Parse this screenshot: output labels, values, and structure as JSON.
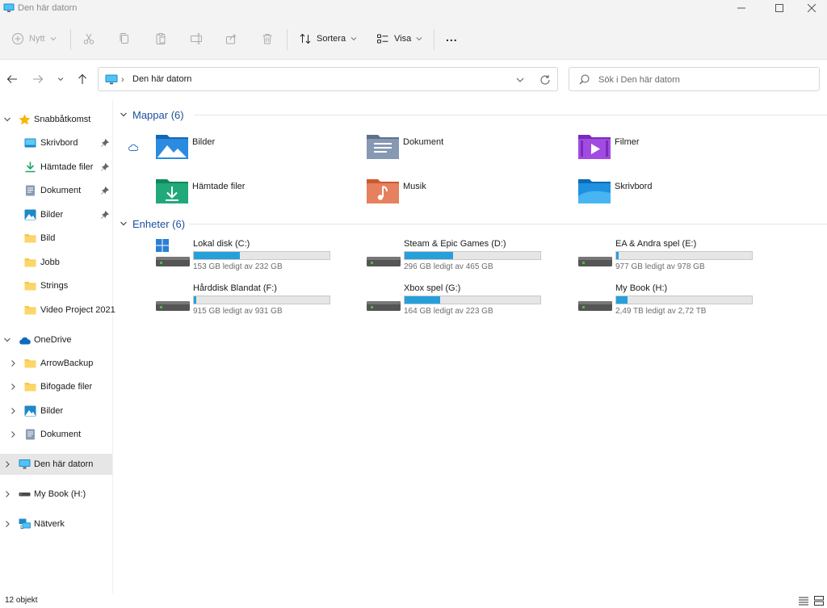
{
  "window": {
    "title": "Den här datorn"
  },
  "toolbar": {
    "new_label": "Nytt",
    "sort_label": "Sortera",
    "view_label": "Visa",
    "more_label": "..."
  },
  "address": {
    "path": "Den här datorn",
    "search_placeholder": "Sök i Den här datorn"
  },
  "sidebar": {
    "quick_access": {
      "label": "Snabbåtkomst",
      "items": [
        {
          "label": "Skrivbord",
          "icon": "desktop-icon",
          "pinned": true
        },
        {
          "label": "Hämtade filer",
          "icon": "download-icon",
          "pinned": true
        },
        {
          "label": "Dokument",
          "icon": "document-icon",
          "pinned": true
        },
        {
          "label": "Bilder",
          "icon": "pictures-icon",
          "pinned": true
        },
        {
          "label": "Bild",
          "icon": "folder-icon",
          "pinned": false
        },
        {
          "label": "Jobb",
          "icon": "folder-icon",
          "pinned": false
        },
        {
          "label": "Strings",
          "icon": "folder-icon",
          "pinned": false
        },
        {
          "label": "Video Project 2021",
          "icon": "folder-icon",
          "pinned": false
        }
      ]
    },
    "onedrive": {
      "label": "OneDrive",
      "items": [
        {
          "label": "ArrowBackup",
          "icon": "folder-icon"
        },
        {
          "label": "Bifogade filer",
          "icon": "folder-icon"
        },
        {
          "label": "Bilder",
          "icon": "pictures-icon"
        },
        {
          "label": "Dokument",
          "icon": "document-icon"
        }
      ]
    },
    "this_pc": {
      "label": "Den här datorn"
    },
    "my_book": {
      "label": "My Book (H:)"
    },
    "network": {
      "label": "Nätverk"
    }
  },
  "folders": {
    "header": "Mappar (6)",
    "items": [
      {
        "name": "Bilder",
        "icon": "pictures-folder-icon"
      },
      {
        "name": "Dokument",
        "icon": "documents-folder-icon"
      },
      {
        "name": "Filmer",
        "icon": "videos-folder-icon"
      },
      {
        "name": "Hämtade filer",
        "icon": "downloads-folder-icon"
      },
      {
        "name": "Musik",
        "icon": "music-folder-icon"
      },
      {
        "name": "Skrivbord",
        "icon": "desktop-folder-icon"
      }
    ]
  },
  "drives": {
    "header": "Enheter (6)",
    "items": [
      {
        "name": "Lokal disk (C:)",
        "free": "153 GB ledigt av 232 GB",
        "used_fraction": 0.34,
        "icon": "windows-drive-icon"
      },
      {
        "name": "Steam & Epic Games (D:)",
        "free": "296 GB ledigt av 465 GB",
        "used_fraction": 0.36,
        "icon": "hard-drive-icon"
      },
      {
        "name": "EA & Andra spel (E:)",
        "free": "977 GB ledigt av 978 GB",
        "used_fraction": 0.001,
        "icon": "hard-drive-icon"
      },
      {
        "name": "Hårddisk Blandat (F:)",
        "free": "915 GB ledigt av 931 GB",
        "used_fraction": 0.017,
        "icon": "hard-drive-icon"
      },
      {
        "name": "Xbox spel (G:)",
        "free": "164 GB ledigt av 223 GB",
        "used_fraction": 0.26,
        "icon": "hard-drive-icon"
      },
      {
        "name": "My Book (H:)",
        "free": "2,49 TB ledigt av 2,72 TB",
        "used_fraction": 0.085,
        "icon": "hard-drive-icon"
      }
    ]
  },
  "status": {
    "count": "12 objekt"
  },
  "colors": {
    "accent": "#1b4f9c",
    "drive_bar": "#26a0da",
    "selected": "#e6e6e6"
  }
}
